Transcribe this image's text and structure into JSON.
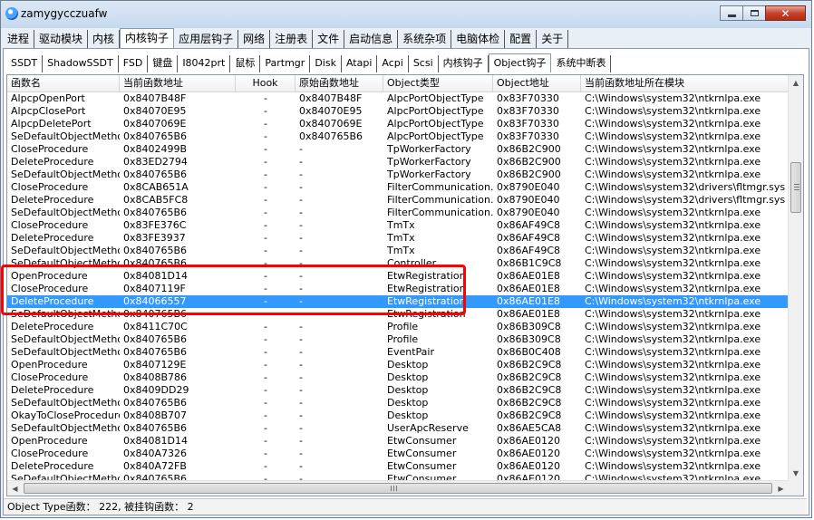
{
  "window": {
    "title": "zamygycczuafw",
    "close_symbol": "✕"
  },
  "main_tabs": [
    "进程",
    "驱动模块",
    "内核",
    "内核钩子",
    "应用层钩子",
    "网络",
    "注册表",
    "文件",
    "启动信息",
    "系统杂项",
    "电脑体检",
    "配置",
    "关于"
  ],
  "main_tabs_active": 3,
  "sub_tabs": [
    "SSDT",
    "ShadowSSDT",
    "FSD",
    "键盘",
    "I8042prt",
    "鼠标",
    "Partmgr",
    "Disk",
    "Atapi",
    "Acpi",
    "Scsi",
    "内核钩子",
    "Object钩子",
    "系统中断表"
  ],
  "sub_tabs_active": 12,
  "columns": [
    "函数名",
    "当前函数地址",
    "Hook",
    "原始函数地址",
    "Object类型",
    "Object地址",
    "当前函数地址所在模块"
  ],
  "rows": [
    [
      "AlpcpOpenPort",
      "0x8407B48F",
      "-",
      "0x8407B48F",
      "AlpcPortObjectType",
      "0x83F70330",
      "C:\\Windows\\system32\\ntkrnlpa.exe"
    ],
    [
      "AlpcpClosePort",
      "0x84070E95",
      "-",
      "0x84070E95",
      "AlpcPortObjectType",
      "0x83F70330",
      "C:\\Windows\\system32\\ntkrnlpa.exe"
    ],
    [
      "AlpcpDeletePort",
      "0x8407069E",
      "-",
      "0x8407069E",
      "AlpcPortObjectType",
      "0x83F70330",
      "C:\\Windows\\system32\\ntkrnlpa.exe"
    ],
    [
      "SeDefaultObjectMethod",
      "0x840765B6",
      "-",
      "0x840765B6",
      "AlpcPortObjectType",
      "0x83F70330",
      "C:\\Windows\\system32\\ntkrnlpa.exe"
    ],
    [
      "CloseProcedure",
      "0x8402499B",
      "-",
      "-",
      "TpWorkerFactory",
      "0x86B2C900",
      "C:\\Windows\\system32\\ntkrnlpa.exe"
    ],
    [
      "DeleteProcedure",
      "0x83ED2794",
      "-",
      "-",
      "TpWorkerFactory",
      "0x86B2C900",
      "C:\\Windows\\system32\\ntkrnlpa.exe"
    ],
    [
      "SeDefaultObjectMethod",
      "0x840765B6",
      "-",
      "-",
      "TpWorkerFactory",
      "0x86B2C900",
      "C:\\Windows\\system32\\ntkrnlpa.exe"
    ],
    [
      "CloseProcedure",
      "0x8CAB651A",
      "-",
      "-",
      "FilterCommunication...",
      "0x8790E040",
      "C:\\Windows\\system32\\drivers\\fltmgr.sys"
    ],
    [
      "DeleteProcedure",
      "0x8CAB5FC8",
      "-",
      "-",
      "FilterCommunication...",
      "0x8790E040",
      "C:\\Windows\\system32\\drivers\\fltmgr.sys"
    ],
    [
      "SeDefaultObjectMethod",
      "0x840765B6",
      "-",
      "-",
      "FilterCommunication...",
      "0x8790E040",
      "C:\\Windows\\system32\\ntkrnlpa.exe"
    ],
    [
      "CloseProcedure",
      "0x83FE376C",
      "-",
      "-",
      "TmTx",
      "0x86AF49C8",
      "C:\\Windows\\system32\\ntkrnlpa.exe"
    ],
    [
      "DeleteProcedure",
      "0x83FE3937",
      "-",
      "-",
      "TmTx",
      "0x86AF49C8",
      "C:\\Windows\\system32\\ntkrnlpa.exe"
    ],
    [
      "SeDefaultObjectMethod",
      "0x840765B6",
      "-",
      "-",
      "TmTx",
      "0x86AF49C8",
      "C:\\Windows\\system32\\ntkrnlpa.exe"
    ],
    [
      "SeDefaultObjectMethod",
      "0x840765B6",
      "-",
      "-",
      "Controller",
      "0x86B1C9C8",
      "C:\\Windows\\system32\\ntkrnlpa.exe"
    ],
    [
      "OpenProcedure",
      "0x84081D14",
      "-",
      "-",
      "EtwRegistration",
      "0x86AE01E8",
      "C:\\Windows\\system32\\ntkrnlpa.exe"
    ],
    [
      "CloseProcedure",
      "0x8407119F",
      "-",
      "-",
      "EtwRegistration",
      "0x86AE01E8",
      "C:\\Windows\\system32\\ntkrnlpa.exe"
    ],
    [
      "DeleteProcedure",
      "0x84066557",
      "-",
      "-",
      "EtwRegistration",
      "0x86AE01E8",
      "C:\\Windows\\system32\\ntkrnlpa.exe"
    ],
    [
      "SeDefaultObjectMethod",
      "0x840765B6",
      "-",
      "-",
      "EtwRegistration",
      "0x86AE01E8",
      "C:\\Windows\\system32\\ntkrnlpa.exe"
    ],
    [
      "DeleteProcedure",
      "0x8411C70C",
      "-",
      "-",
      "Profile",
      "0x86B309C8",
      "C:\\Windows\\system32\\ntkrnlpa.exe"
    ],
    [
      "SeDefaultObjectMethod",
      "0x840765B6",
      "-",
      "-",
      "Profile",
      "0x86B309C8",
      "C:\\Windows\\system32\\ntkrnlpa.exe"
    ],
    [
      "SeDefaultObjectMethod",
      "0x840765B6",
      "-",
      "-",
      "EventPair",
      "0x86B0C408",
      "C:\\Windows\\system32\\ntkrnlpa.exe"
    ],
    [
      "OpenProcedure",
      "0x8407129E",
      "-",
      "-",
      "Desktop",
      "0x86B2C9C8",
      "C:\\Windows\\system32\\ntkrnlpa.exe"
    ],
    [
      "CloseProcedure",
      "0x8408B786",
      "-",
      "-",
      "Desktop",
      "0x86B2C9C8",
      "C:\\Windows\\system32\\ntkrnlpa.exe"
    ],
    [
      "DeleteProcedure",
      "0x8409DD29",
      "-",
      "-",
      "Desktop",
      "0x86B2C9C8",
      "C:\\Windows\\system32\\ntkrnlpa.exe"
    ],
    [
      "SeDefaultObjectMethod",
      "0x840765B6",
      "-",
      "-",
      "Desktop",
      "0x86B2C9C8",
      "C:\\Windows\\system32\\ntkrnlpa.exe"
    ],
    [
      "OkayToCloseProcedure",
      "0x8408B707",
      "-",
      "-",
      "Desktop",
      "0x86B2C9C8",
      "C:\\Windows\\system32\\ntkrnlpa.exe"
    ],
    [
      "SeDefaultObjectMethod",
      "0x840765B6",
      "-",
      "-",
      "UserApcReserve",
      "0x86AE5CA8",
      "C:\\Windows\\system32\\ntkrnlpa.exe"
    ],
    [
      "OpenProcedure",
      "0x84081D14",
      "-",
      "-",
      "EtwConsumer",
      "0x86AE0120",
      "C:\\Windows\\system32\\ntkrnlpa.exe"
    ],
    [
      "CloseProcedure",
      "0x840A7326",
      "-",
      "-",
      "EtwConsumer",
      "0x86AE0120",
      "C:\\Windows\\system32\\ntkrnlpa.exe"
    ],
    [
      "DeleteProcedure",
      "0x840A72FB",
      "-",
      "-",
      "EtwConsumer",
      "0x86AE0120",
      "C:\\Windows\\system32\\ntkrnlpa.exe"
    ],
    [
      "SeDefaultObjectMethod",
      "0x840765B6",
      "-",
      "-",
      "EtwConsumer",
      "0x86AE0120",
      "C:\\Windows\\system32\\ntkrnlpa.exe"
    ]
  ],
  "selected_row": 16,
  "status": "Object Type函数： 222, 被挂钩函数： 2",
  "colors": {
    "selection": "#3399ff",
    "highlight_box": "#ff0000"
  }
}
